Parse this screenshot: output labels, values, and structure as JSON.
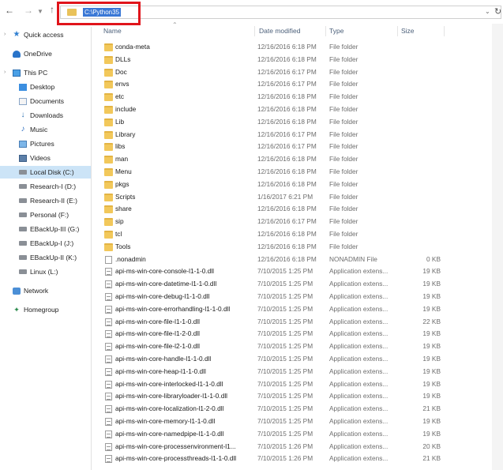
{
  "address": {
    "path": "C:\\Python35"
  },
  "sidebar": {
    "items": [
      {
        "label": "Quick access",
        "icon": "star-icon"
      },
      {
        "label": "OneDrive",
        "icon": "cloud-icon"
      },
      {
        "label": "This PC",
        "icon": "computer-icon"
      },
      {
        "label": "Desktop",
        "icon": "desktop-icon"
      },
      {
        "label": "Documents",
        "icon": "documents-icon"
      },
      {
        "label": "Downloads",
        "icon": "download-icon"
      },
      {
        "label": "Music",
        "icon": "music-icon"
      },
      {
        "label": "Pictures",
        "icon": "pictures-icon"
      },
      {
        "label": "Videos",
        "icon": "videos-icon"
      },
      {
        "label": "Local Disk (C:)",
        "icon": "disk-icon"
      },
      {
        "label": "Research-I (D:)",
        "icon": "disk-icon"
      },
      {
        "label": "Research-II (E:)",
        "icon": "disk-icon"
      },
      {
        "label": "Personal (F:)",
        "icon": "disk-icon"
      },
      {
        "label": "EBackUp-III (G:)",
        "icon": "disk-icon"
      },
      {
        "label": "EBackUp-I (J:)",
        "icon": "disk-icon"
      },
      {
        "label": "EBackUp-II (K:)",
        "icon": "disk-icon"
      },
      {
        "label": "Linux (L:)",
        "icon": "disk-icon"
      },
      {
        "label": "Network",
        "icon": "network-icon"
      },
      {
        "label": "Homegroup",
        "icon": "homegroup-icon"
      }
    ]
  },
  "columns": {
    "name": "Name",
    "date": "Date modified",
    "type": "Type",
    "size": "Size"
  },
  "files": [
    {
      "name": "conda-meta",
      "date": "12/16/2016 6:18 PM",
      "type": "File folder",
      "size": "",
      "kind": "folder"
    },
    {
      "name": "DLLs",
      "date": "12/16/2016 6:18 PM",
      "type": "File folder",
      "size": "",
      "kind": "folder"
    },
    {
      "name": "Doc",
      "date": "12/16/2016 6:17 PM",
      "type": "File folder",
      "size": "",
      "kind": "folder"
    },
    {
      "name": "envs",
      "date": "12/16/2016 6:17 PM",
      "type": "File folder",
      "size": "",
      "kind": "folder"
    },
    {
      "name": "etc",
      "date": "12/16/2016 6:18 PM",
      "type": "File folder",
      "size": "",
      "kind": "folder"
    },
    {
      "name": "include",
      "date": "12/16/2016 6:18 PM",
      "type": "File folder",
      "size": "",
      "kind": "folder"
    },
    {
      "name": "Lib",
      "date": "12/16/2016 6:18 PM",
      "type": "File folder",
      "size": "",
      "kind": "folder"
    },
    {
      "name": "Library",
      "date": "12/16/2016 6:17 PM",
      "type": "File folder",
      "size": "",
      "kind": "folder"
    },
    {
      "name": "libs",
      "date": "12/16/2016 6:17 PM",
      "type": "File folder",
      "size": "",
      "kind": "folder"
    },
    {
      "name": "man",
      "date": "12/16/2016 6:18 PM",
      "type": "File folder",
      "size": "",
      "kind": "folder"
    },
    {
      "name": "Menu",
      "date": "12/16/2016 6:18 PM",
      "type": "File folder",
      "size": "",
      "kind": "folder"
    },
    {
      "name": "pkgs",
      "date": "12/16/2016 6:18 PM",
      "type": "File folder",
      "size": "",
      "kind": "folder"
    },
    {
      "name": "Scripts",
      "date": "1/16/2017 6:21 PM",
      "type": "File folder",
      "size": "",
      "kind": "folder"
    },
    {
      "name": "share",
      "date": "12/16/2016 6:18 PM",
      "type": "File folder",
      "size": "",
      "kind": "folder"
    },
    {
      "name": "sip",
      "date": "12/16/2016 6:17 PM",
      "type": "File folder",
      "size": "",
      "kind": "folder"
    },
    {
      "name": "tcl",
      "date": "12/16/2016 6:18 PM",
      "type": "File folder",
      "size": "",
      "kind": "folder"
    },
    {
      "name": "Tools",
      "date": "12/16/2016 6:18 PM",
      "type": "File folder",
      "size": "",
      "kind": "folder"
    },
    {
      "name": ".nonadmin",
      "date": "12/16/2016 6:18 PM",
      "type": "NONADMIN File",
      "size": "0 KB",
      "kind": "file"
    },
    {
      "name": "api-ms-win-core-console-l1-1-0.dll",
      "date": "7/10/2015 1:25 PM",
      "type": "Application extens...",
      "size": "19 KB",
      "kind": "dll"
    },
    {
      "name": "api-ms-win-core-datetime-l1-1-0.dll",
      "date": "7/10/2015 1:25 PM",
      "type": "Application extens...",
      "size": "19 KB",
      "kind": "dll"
    },
    {
      "name": "api-ms-win-core-debug-l1-1-0.dll",
      "date": "7/10/2015 1:25 PM",
      "type": "Application extens...",
      "size": "19 KB",
      "kind": "dll"
    },
    {
      "name": "api-ms-win-core-errorhandling-l1-1-0.dll",
      "date": "7/10/2015 1:25 PM",
      "type": "Application extens...",
      "size": "19 KB",
      "kind": "dll"
    },
    {
      "name": "api-ms-win-core-file-l1-1-0.dll",
      "date": "7/10/2015 1:25 PM",
      "type": "Application extens...",
      "size": "22 KB",
      "kind": "dll"
    },
    {
      "name": "api-ms-win-core-file-l1-2-0.dll",
      "date": "7/10/2015 1:25 PM",
      "type": "Application extens...",
      "size": "19 KB",
      "kind": "dll"
    },
    {
      "name": "api-ms-win-core-file-l2-1-0.dll",
      "date": "7/10/2015 1:25 PM",
      "type": "Application extens...",
      "size": "19 KB",
      "kind": "dll"
    },
    {
      "name": "api-ms-win-core-handle-l1-1-0.dll",
      "date": "7/10/2015 1:25 PM",
      "type": "Application extens...",
      "size": "19 KB",
      "kind": "dll"
    },
    {
      "name": "api-ms-win-core-heap-l1-1-0.dll",
      "date": "7/10/2015 1:25 PM",
      "type": "Application extens...",
      "size": "19 KB",
      "kind": "dll"
    },
    {
      "name": "api-ms-win-core-interlocked-l1-1-0.dll",
      "date": "7/10/2015 1:25 PM",
      "type": "Application extens...",
      "size": "19 KB",
      "kind": "dll"
    },
    {
      "name": "api-ms-win-core-libraryloader-l1-1-0.dll",
      "date": "7/10/2015 1:25 PM",
      "type": "Application extens...",
      "size": "19 KB",
      "kind": "dll"
    },
    {
      "name": "api-ms-win-core-localization-l1-2-0.dll",
      "date": "7/10/2015 1:25 PM",
      "type": "Application extens...",
      "size": "21 KB",
      "kind": "dll"
    },
    {
      "name": "api-ms-win-core-memory-l1-1-0.dll",
      "date": "7/10/2015 1:25 PM",
      "type": "Application extens...",
      "size": "19 KB",
      "kind": "dll"
    },
    {
      "name": "api-ms-win-core-namedpipe-l1-1-0.dll",
      "date": "7/10/2015 1:25 PM",
      "type": "Application extens...",
      "size": "19 KB",
      "kind": "dll"
    },
    {
      "name": "api-ms-win-core-processenvironment-l1...",
      "date": "7/10/2015 1:26 PM",
      "type": "Application extens...",
      "size": "20 KB",
      "kind": "dll"
    },
    {
      "name": "api-ms-win-core-processthreads-l1-1-0.dll",
      "date": "7/10/2015 1:26 PM",
      "type": "Application extens...",
      "size": "21 KB",
      "kind": "dll"
    }
  ],
  "colors": {
    "selection": "#cce4f7",
    "highlight_box": "#e0141b",
    "address_selection": "#3a78d6",
    "folder": "#f2c85b"
  }
}
